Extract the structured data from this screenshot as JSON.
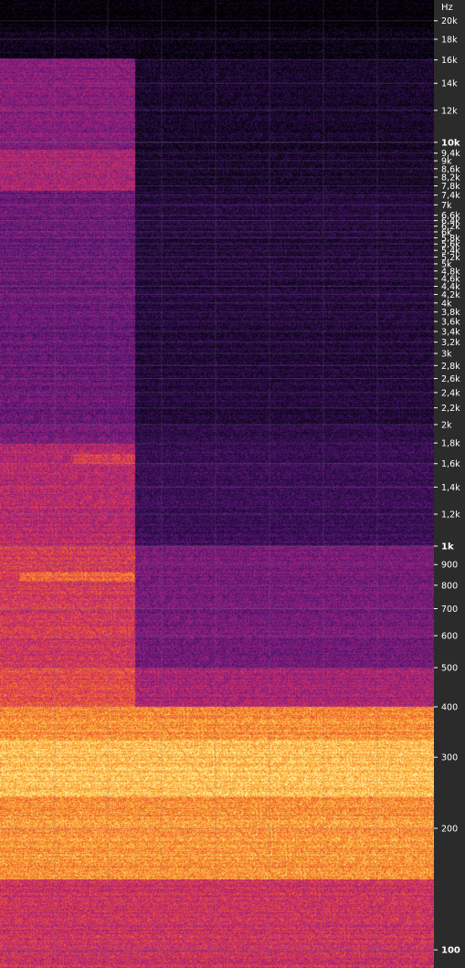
{
  "chart_data": {
    "type": "heatmap",
    "title": "",
    "ylabel": "Hz",
    "yscale": "log",
    "ylim": [
      95,
      20500
    ],
    "yticks": [
      {
        "value": 20000,
        "label": "20k"
      },
      {
        "value": 18000,
        "label": "18k"
      },
      {
        "value": 16000,
        "label": "16k"
      },
      {
        "value": 14000,
        "label": "14k"
      },
      {
        "value": 12000,
        "label": "12k"
      },
      {
        "value": 10000,
        "label": "10k"
      },
      {
        "value": 9400,
        "label": "9,4k"
      },
      {
        "value": 9000,
        "label": "9k"
      },
      {
        "value": 8600,
        "label": "8,6k"
      },
      {
        "value": 8200,
        "label": "8,2k"
      },
      {
        "value": 7800,
        "label": "7,8k"
      },
      {
        "value": 7400,
        "label": "7,4k"
      },
      {
        "value": 7000,
        "label": "7k"
      },
      {
        "value": 6600,
        "label": "6,6k"
      },
      {
        "value": 6400,
        "label": "6,4k"
      },
      {
        "value": 6200,
        "label": "6,2k"
      },
      {
        "value": 6000,
        "label": "6k"
      },
      {
        "value": 5800,
        "label": "5,8k"
      },
      {
        "value": 5600,
        "label": "5,6k"
      },
      {
        "value": 5400,
        "label": "5,4k"
      },
      {
        "value": 5200,
        "label": "5,2k"
      },
      {
        "value": 5000,
        "label": "5k"
      },
      {
        "value": 4800,
        "label": "4,8k"
      },
      {
        "value": 4600,
        "label": "4,6k"
      },
      {
        "value": 4400,
        "label": "4,4k"
      },
      {
        "value": 4200,
        "label": "4,2k"
      },
      {
        "value": 4000,
        "label": "4k"
      },
      {
        "value": 3800,
        "label": "3,8k"
      },
      {
        "value": 3600,
        "label": "3,6k"
      },
      {
        "value": 3400,
        "label": "3,4k"
      },
      {
        "value": 3200,
        "label": "3,2k"
      },
      {
        "value": 3000,
        "label": "3k"
      },
      {
        "value": 2800,
        "label": "2,8k"
      },
      {
        "value": 2600,
        "label": "2,6k"
      },
      {
        "value": 2400,
        "label": "2,4k"
      },
      {
        "value": 2200,
        "label": "2,2k"
      },
      {
        "value": 2000,
        "label": "2k"
      },
      {
        "value": 1800,
        "label": "1,8k"
      },
      {
        "value": 1600,
        "label": "1,6k"
      },
      {
        "value": 1400,
        "label": "1,4k"
      },
      {
        "value": 1200,
        "label": "1,2k"
      },
      {
        "value": 1000,
        "label": "1k"
      },
      {
        "value": 900,
        "label": "900"
      },
      {
        "value": 800,
        "label": "800"
      },
      {
        "value": 700,
        "label": "700"
      },
      {
        "value": 600,
        "label": "600"
      },
      {
        "value": 500,
        "label": "500"
      },
      {
        "value": 400,
        "label": "400"
      },
      {
        "value": 300,
        "label": "300"
      },
      {
        "value": 200,
        "label": "200"
      },
      {
        "value": 100,
        "label": "100"
      }
    ],
    "bold_ticks": [
      10000,
      1000,
      100
    ],
    "colormap": [
      "#000000",
      "#1a0a2e",
      "#3b0f5c",
      "#6a1a7a",
      "#a0227a",
      "#d8345a",
      "#f26b2a",
      "#fbb43a",
      "#fff2a0"
    ],
    "grid": true,
    "colors": {
      "axis_bg": "#2b2b2b",
      "tick_label": "#ffffff",
      "grid": "#7a6a8a"
    }
  }
}
